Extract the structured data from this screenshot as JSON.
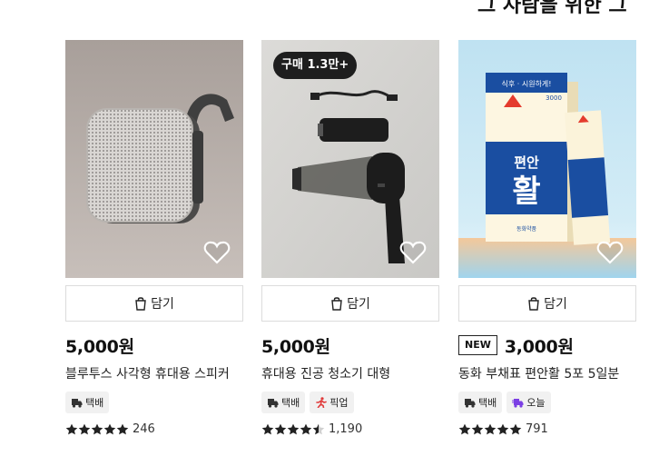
{
  "heading": "그 사람을 위한 그",
  "cart_label": "담기",
  "products": [
    {
      "price": "5,000원",
      "title": "블루투스 사각형 휴대용 스피커",
      "badge": "",
      "new_label": "",
      "tags": [
        {
          "icon": "truck-icon",
          "label": "택배",
          "color": "#333333"
        }
      ],
      "rating": 5,
      "review_count": "246"
    },
    {
      "price": "5,000원",
      "title": "휴대용 진공 청소기 대형",
      "badge": "구매 1.3만+",
      "new_label": "",
      "tags": [
        {
          "icon": "truck-icon",
          "label": "택배",
          "color": "#333333"
        },
        {
          "icon": "person-run-icon",
          "label": "픽업",
          "color": "#e03a3a"
        }
      ],
      "rating": 4.5,
      "review_count": "1,190"
    },
    {
      "price": "3,000원",
      "title": "동화 부채표 편안활 5포 5일분",
      "badge": "",
      "new_label": "NEW",
      "tags": [
        {
          "icon": "truck-icon",
          "label": "택배",
          "color": "#333333"
        },
        {
          "icon": "fast-truck-icon",
          "label": "오늘",
          "color": "#7b3fe4"
        }
      ],
      "rating": 5,
      "review_count": "791"
    }
  ],
  "package_text": {
    "slogan": "식후 · 시원하게!",
    "price_tag": "3000",
    "name_top": "편안",
    "name_bottom": "활",
    "brand": "동화약품"
  }
}
